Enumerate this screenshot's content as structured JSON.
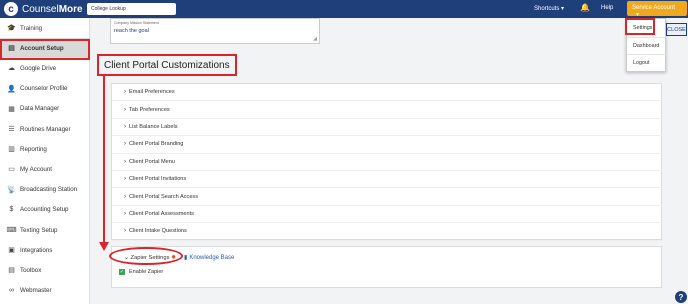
{
  "app": {
    "logo_letter": "c",
    "name_plain": "Counsel",
    "name_bold": "More"
  },
  "topbar": {
    "search_value": "College Lookup",
    "shortcuts": "Shortcuts",
    "help": "Help",
    "account": "Service Account",
    "shortcuts_caret": "▾",
    "account_caret": "▾"
  },
  "sidebar": {
    "items": [
      {
        "label": "Training",
        "icon": "graduation-cap-icon",
        "glyph": "🎓"
      },
      {
        "label": "Account Setup",
        "icon": "id-card-icon",
        "glyph": "▤"
      },
      {
        "label": "Google Drive",
        "icon": "cloud-icon",
        "glyph": "☁"
      },
      {
        "label": "Counselor Profile",
        "icon": "user-icon",
        "glyph": "👤"
      },
      {
        "label": "Data Manager",
        "icon": "table-icon",
        "glyph": "▦"
      },
      {
        "label": "Routines Manager",
        "icon": "list-icon",
        "glyph": "☰"
      },
      {
        "label": "Reporting",
        "icon": "chart-icon",
        "glyph": "▥"
      },
      {
        "label": "My Account",
        "icon": "credit-card-icon",
        "glyph": "▭"
      },
      {
        "label": "Broadcasting Station",
        "icon": "broadcast-icon",
        "glyph": "📡"
      },
      {
        "label": "Accounting Setup",
        "icon": "dollar-icon",
        "glyph": "$"
      },
      {
        "label": "Texting Setup",
        "icon": "keyboard-icon",
        "glyph": "⌨"
      },
      {
        "label": "Integrations",
        "icon": "integrations-icon",
        "glyph": "▣"
      },
      {
        "label": "Toolbox",
        "icon": "toolbox-icon",
        "glyph": "▤"
      },
      {
        "label": "Webmaster",
        "icon": "link-icon",
        "glyph": "∞"
      }
    ]
  },
  "mission": {
    "label": "Company Mission Statement",
    "value": "reach the goal"
  },
  "section": {
    "title": "Client Portal Customizations"
  },
  "accordion": {
    "chevron": "›",
    "items": [
      "Email Preferences",
      "Tab Preferences",
      "List Balance Labels",
      "Client Portal Branding",
      "Client Portal Menu",
      "Client Portal Invitations",
      "Client Portal Search Access",
      "Client Portal Assessments",
      "Client Intake Questions"
    ]
  },
  "zapier": {
    "chevron": "⌄",
    "title": "Zapier Settings",
    "gear": "✹",
    "book": "▮",
    "kb_link": "Knowledge Base",
    "check": "✓",
    "enable_label": "Enable Zapier"
  },
  "dropdown": {
    "items": [
      "Settings",
      "Dashboard",
      "Logout"
    ]
  },
  "close_button": "CLOSE",
  "help_bubble": "?",
  "bell_glyph": "🔔",
  "resize_glyph": "◢",
  "colors": {
    "brand": "#1f3f7a",
    "accent": "#f0a81c",
    "highlight": "#d8262b",
    "check": "#3ca44c"
  }
}
